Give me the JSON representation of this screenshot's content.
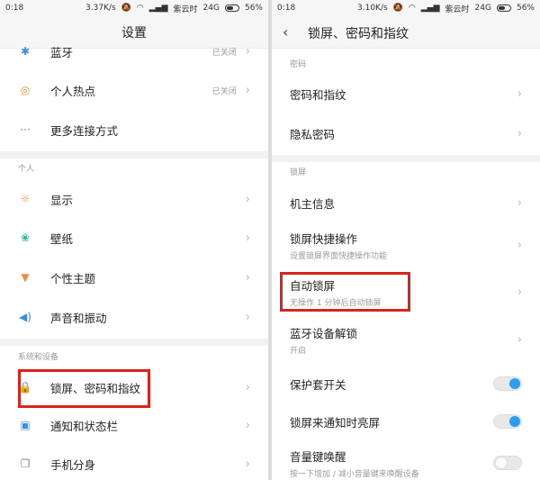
{
  "left": {
    "status": {
      "time": "0:18",
      "speed": "3.37K/s",
      "carrier": "紫云时",
      "network": "24G",
      "battery": "56%"
    },
    "title": "设置",
    "top_items": [
      {
        "label": "蓝牙",
        "value": "已关闭"
      },
      {
        "label": "个人热点",
        "value": "已关闭"
      },
      {
        "label": "更多连接方式"
      }
    ],
    "section_personal": "个人",
    "personal_items": [
      {
        "label": "显示"
      },
      {
        "label": "壁纸"
      },
      {
        "label": "个性主题"
      },
      {
        "label": "声音和振动"
      }
    ],
    "section_system": "系统和设备",
    "system_items": [
      {
        "label": "锁屏、密码和指纹"
      },
      {
        "label": "通知和状态栏"
      },
      {
        "label": "手机分身"
      }
    ]
  },
  "right": {
    "status": {
      "time": "0:18",
      "speed": "3.10K/s",
      "carrier": "紫云时",
      "network": "24G",
      "battery": "56%"
    },
    "title": "锁屏、密码和指纹",
    "section_password": "密码",
    "password_items": [
      {
        "label": "密码和指纹"
      },
      {
        "label": "隐私密码"
      }
    ],
    "section_lock": "锁屏",
    "lock_items": [
      {
        "label": "机主信息"
      },
      {
        "label": "锁屏快捷操作",
        "sub": "设置锁屏界面快捷操作功能"
      },
      {
        "label": "自动锁屏",
        "sub": "无操作 1 分钟后自动锁屏"
      },
      {
        "label": "蓝牙设备解锁",
        "sub": "开启"
      },
      {
        "label": "保护套开关",
        "toggle": "on"
      },
      {
        "label": "锁屏来通知时亮屏",
        "toggle": "on"
      },
      {
        "label": "音量键唤醒",
        "sub": "按一下增加 / 减小音量键来唤醒设备",
        "toggle": "off"
      }
    ]
  },
  "icons": {
    "bluetooth": "bluetooth-icon",
    "hotspot": "hotspot-icon",
    "more": "more-icon",
    "display": "display-icon",
    "wallpaper": "wallpaper-icon",
    "theme": "theme-icon",
    "sound": "sound-icon",
    "lock": "lock-icon",
    "notify": "notification-icon",
    "dual": "dual-app-icon",
    "chevron": "chevron-right-icon",
    "back": "back-arrow-icon"
  },
  "colors": {
    "highlight": "#d9231b",
    "toggle_on": "#2e9cf3",
    "icon_orange": "#f28a3a"
  }
}
